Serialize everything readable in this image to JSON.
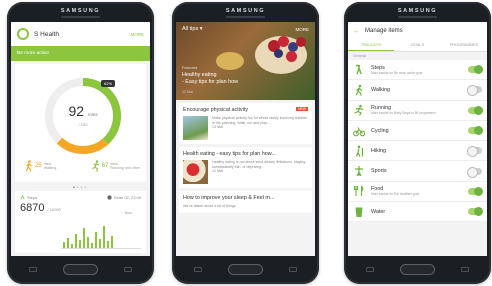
{
  "colors": {
    "accent": "#8cc63f",
    "orange": "#f5a623",
    "badge": "#e8542a",
    "toggle_on": "#6db33f"
  },
  "phones": [
    {
      "brand": "SAMSUNG",
      "app": {
        "logo_icon": "s-health-logo-icon",
        "title": "S Health",
        "more": "MORE",
        "banner": "Be more active",
        "ring": {
          "percent_label": "62%",
          "value": "92",
          "unit": "mins",
          "goal": "/ 150",
          "progress_fraction": 0.62
        },
        "activities": [
          {
            "icon": "walking-icon",
            "value": "25",
            "unit": "mins",
            "label": "Walking"
          },
          {
            "icon": "running-icon",
            "value": "67",
            "unit": "mins",
            "label": "Running and other"
          }
        ],
        "page_dots": 4,
        "steps": {
          "icon": "steps-icon",
          "label": "Steps",
          "date_icon": "clock-icon",
          "date": "Sean 02, 22:05",
          "value": "6870",
          "goal": "/ 10000",
          "now": "Now"
        }
      }
    },
    {
      "brand": "SAMSUNG",
      "feed": {
        "filter": "All tips",
        "more": "MORE",
        "hero": {
          "kicker": "Featured",
          "title_line1": "Healthy eating",
          "title_line2": "- Easy tips for plan how",
          "meta": "12 Mar"
        },
        "cards": [
          {
            "title": "Encourage physical activity",
            "badge": "NEW",
            "text": "Make physical activity fun for whole family involving children in the planning. Walk, run and play...",
            "meta": "13 Mar"
          },
          {
            "title": "Health eating - easy tips for plan how...",
            "text": "Healthy eating is not about strict dietary limitations, staying unrealistically thin, or depriving...",
            "meta": "12 Mar"
          },
          {
            "title": "How to improve your sleep & Feel m...",
            "text": "We've talked about a lot of things"
          }
        ]
      }
    },
    {
      "brand": "SAMSUNG",
      "manage": {
        "back_icon": "back-arrow-icon",
        "title": "Manage items",
        "tabs": [
          "TRACKERS",
          "GOALS",
          "PROGRAMMES"
        ],
        "section": "General",
        "items": [
          {
            "icon": "steps-icon",
            "name": "Steps",
            "sub": "Main tracker for Be more active goal",
            "on": true
          },
          {
            "icon": "walking-icon",
            "name": "Walking",
            "sub": "",
            "on": false
          },
          {
            "icon": "running-icon",
            "name": "Running",
            "sub": "Main tracker for Baby Steps to 5K programme",
            "on": true
          },
          {
            "icon": "cycling-icon",
            "name": "Cycling",
            "sub": "",
            "on": true
          },
          {
            "icon": "hiking-icon",
            "name": "Hiking",
            "sub": "",
            "on": false
          },
          {
            "icon": "sports-icon",
            "name": "Sports",
            "sub": "",
            "on": false
          },
          {
            "icon": "food-icon",
            "name": "Food",
            "sub": "Main tracker for Eat healthier goal",
            "on": true
          },
          {
            "icon": "water-icon",
            "name": "Water",
            "sub": "",
            "on": true
          }
        ]
      }
    }
  ]
}
